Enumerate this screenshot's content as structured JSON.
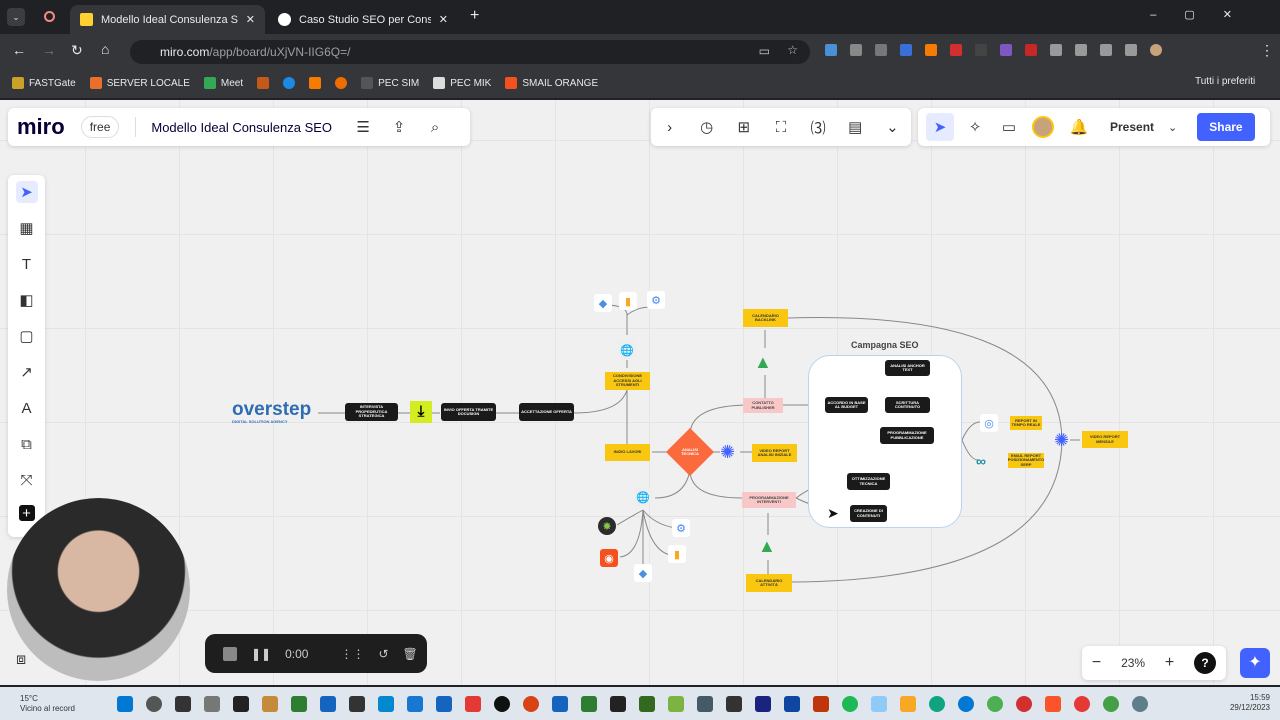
{
  "browser": {
    "tabs": [
      {
        "title": "Modello Ideal Consulenza SEO",
        "active": true
      },
      {
        "title": "Caso Studio SEO per Consulenza L",
        "active": false
      }
    ],
    "url_host": "miro.com",
    "url_path": "/app/board/uXjVN-IIG6Q=/",
    "bookmarks": [
      "FASTGate",
      "SERVER LOCALE",
      "Meet",
      "PEC SIM",
      "PEC MIK",
      "SMAIL ORANGE"
    ],
    "all_bookmarks": "Tutti i preferiti"
  },
  "miro": {
    "logo": "miro",
    "plan": "free",
    "board_title": "Modello Ideal Consulenza SEO",
    "present": "Present",
    "share": "Share",
    "zoom": "23%",
    "help": "?",
    "recording_time": "0:00"
  },
  "board": {
    "logo_text": "overstep",
    "logo_sub": "DIGITAL SOLUTION AGENCY",
    "frame_title": "Campagna SEO",
    "nodes": {
      "intervista": "Intervista propedeutica strategica",
      "invio": "Invio offerta tramite docusign",
      "accettazione": "Accettazione offerta",
      "condivisione": "Condivisione accessi agli strumenti",
      "inizio": "Inizio lavori",
      "analisi": "Analisi tecnica",
      "video_iniziale": "Video report analisi iniziale",
      "calendario_backlink": "Calendario backlink",
      "contatto": "Contatto publisher",
      "programmazione_interventi": "Programmazione interventi",
      "calendario_attivita": "Calendario attività",
      "accordo": "Accordo in base al budget",
      "anchor": "Analisi anchor text",
      "scrittura": "Scrittura contenuto",
      "pubblicazione": "Programmazione pubblicazione",
      "ottimizzazione": "Ottimizzazione tecnica",
      "creazione": "Creazione di contenuti",
      "report_reale": "Report in tempo reale",
      "email_report": "Email report posizionamento SERP",
      "video_mensile": "Video report mensile"
    }
  },
  "taskbar": {
    "weather_temp": "15°C",
    "weather_text": "Vicino al record",
    "time": "15:59",
    "date": "29/12/2023"
  },
  "colors": {
    "accent": "#4262ff",
    "sticky": "#fac710",
    "diamond": "#fa6a3c"
  }
}
